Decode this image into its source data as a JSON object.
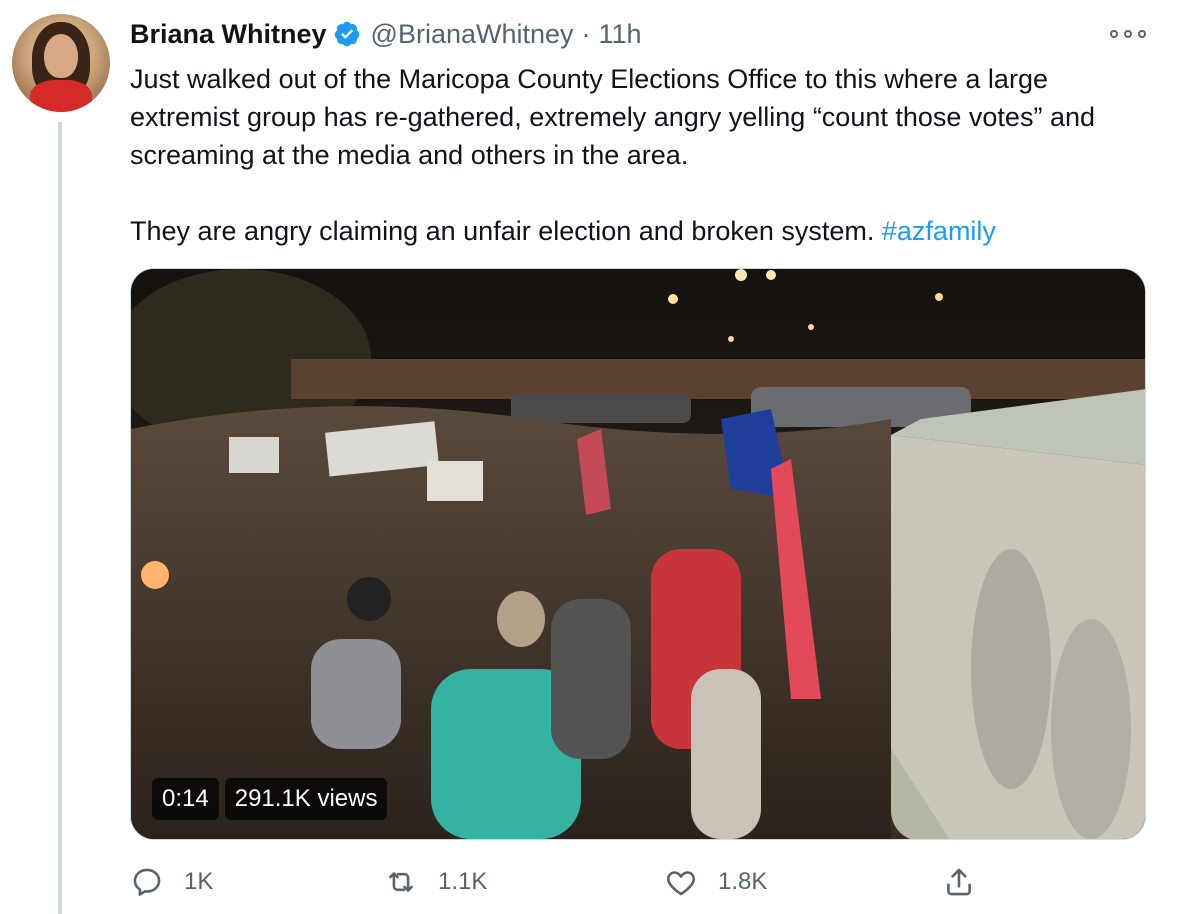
{
  "author": {
    "name": "Briana Whitney",
    "handle": "@BrianaWhitney",
    "separator": "·",
    "time": "11h",
    "verified": true
  },
  "tweet": {
    "paragraph1": "Just walked out of the Maricopa County Elections Office to this where a large extremist group has re-gathered, extremely angry yelling “count those votes” and screaming at the media and others in the area.",
    "paragraph2_text": "They are angry claiming an unfair election and broken system. ",
    "hashtag": "#azfamily"
  },
  "video": {
    "duration": "0:14",
    "views": "291.1K views"
  },
  "actions": {
    "replies": "1K",
    "retweets": "1.1K",
    "likes": "1.8K"
  },
  "colors": {
    "accent": "#1d9bf0",
    "text": "#0f1419",
    "secondary": "#536471",
    "verified_badge": "#1d9bf0"
  },
  "icons": [
    "more-icon",
    "verified-badge-icon",
    "reply-icon",
    "retweet-icon",
    "like-icon",
    "share-icon"
  ]
}
